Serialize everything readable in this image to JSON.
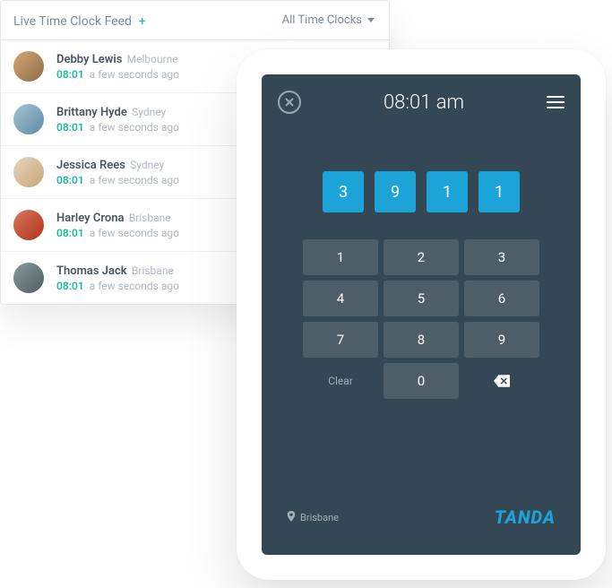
{
  "feed": {
    "title": "Live Time Clock Feed",
    "plus": "+",
    "filter": "All Time Clocks",
    "items": [
      {
        "name": "Debby Lewis",
        "location": "Melbourne",
        "time": "08:01",
        "ago": "a few seconds ago"
      },
      {
        "name": "Brittany Hyde",
        "location": "Sydney",
        "time": "08:01",
        "ago": "a few seconds ago"
      },
      {
        "name": "Jessica Rees",
        "location": "Sydney",
        "time": "08:01",
        "ago": "a few seconds ago"
      },
      {
        "name": "Harley Crona",
        "location": "Brisbane",
        "time": "08:01",
        "ago": "a few seconds ago"
      },
      {
        "name": "Thomas Jack",
        "location": "Brisbane",
        "time": "08:01",
        "ago": "a few seconds ago"
      }
    ]
  },
  "clock": {
    "time": "08:01 am",
    "pin": [
      "3",
      "9",
      "1",
      "1"
    ],
    "keys": [
      "1",
      "2",
      "3",
      "4",
      "5",
      "6",
      "7",
      "8",
      "9"
    ],
    "clear": "Clear",
    "zero": "0",
    "location": "Brisbane",
    "brand": "TANDA"
  }
}
